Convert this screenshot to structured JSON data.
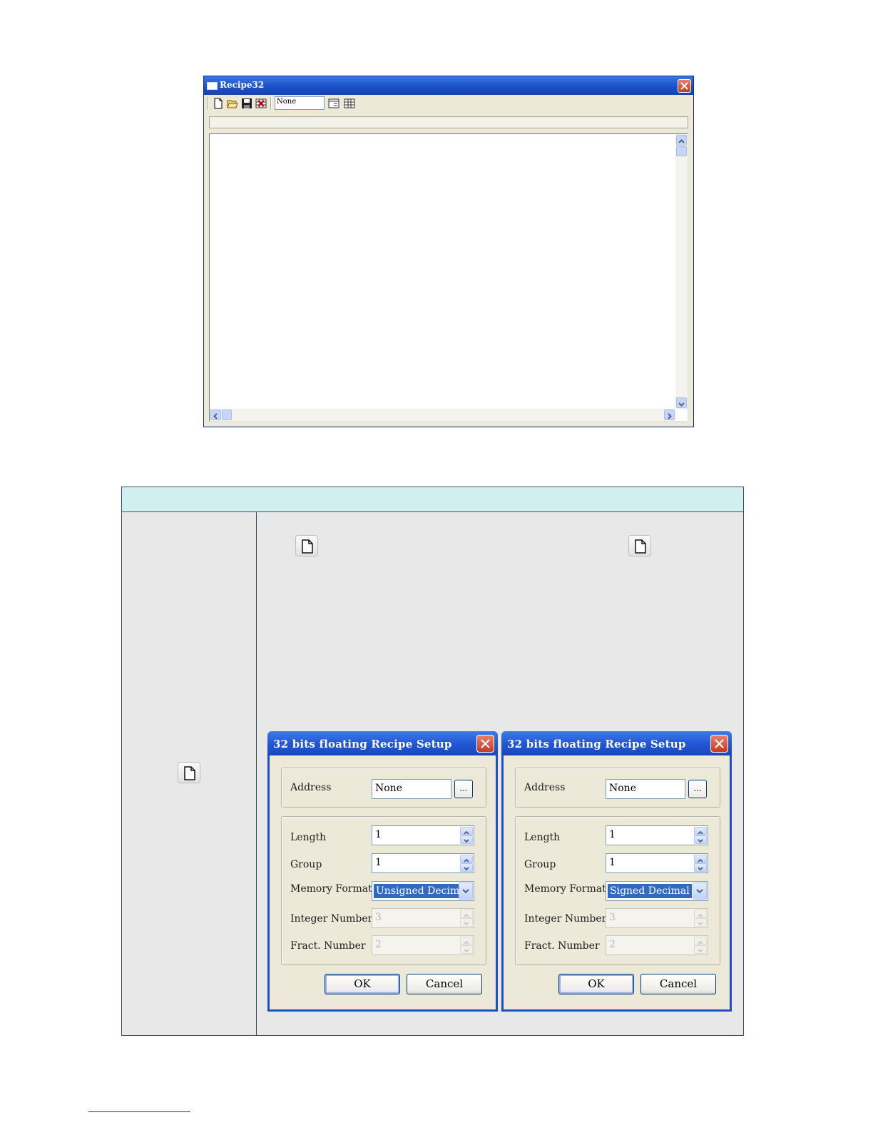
{
  "recipe_window": {
    "title": "Recipe32",
    "toolbar": {
      "address_value": "None",
      "icons": [
        "new-file-icon",
        "open-folder-icon",
        "save-icon",
        "delete-table-icon",
        "table-options-icon",
        "grid-icon"
      ]
    }
  },
  "table_icons": [
    "new-file-icon"
  ],
  "dialogs": [
    {
      "title": "32 bits floating Recipe Setup",
      "address_label": "Address",
      "address_value": "None",
      "browse_label": "...",
      "length_label": "Length",
      "length_value": "1",
      "group_label": "Group",
      "group_value": "1",
      "memory_format_label": "Memory Format",
      "memory_format_value": "Unsigned Decimal",
      "integer_number_label": "Integer Number",
      "integer_number_value": "3",
      "fract_number_label": "Fract. Number",
      "fract_number_value": "2",
      "ok_label": "OK",
      "cancel_label": "Cancel"
    },
    {
      "title": "32 bits floating Recipe Setup",
      "address_label": "Address",
      "address_value": "None",
      "browse_label": "...",
      "length_label": "Length",
      "length_value": "1",
      "group_label": "Group",
      "group_value": "1",
      "memory_format_label": "Memory Format",
      "memory_format_value": "Signed Decimal",
      "integer_number_label": "Integer Number",
      "integer_number_value": "3",
      "fract_number_label": "Fract. Number",
      "fract_number_value": "2",
      "ok_label": "OK",
      "cancel_label": "Cancel"
    }
  ],
  "colors": {
    "titlebar": "#1a4fc6",
    "table_header": "#d2efef",
    "table_body": "#e8e8e8",
    "selection": "#316ac5"
  }
}
